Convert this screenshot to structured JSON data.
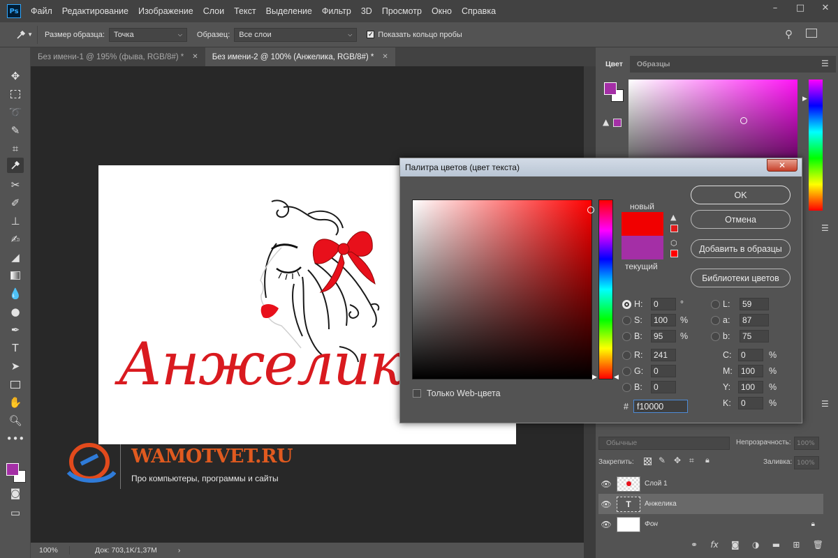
{
  "app": {
    "logo_text": "Ps"
  },
  "menu": [
    "Файл",
    "Редактирование",
    "Изображение",
    "Слои",
    "Текст",
    "Выделение",
    "Фильтр",
    "3D",
    "Просмотр",
    "Окно",
    "Справка"
  ],
  "window_controls": {
    "minimize": "–",
    "maximize": "□",
    "close": "✕"
  },
  "options": {
    "sample_size_label": "Размер образца:",
    "sample_size_value": "Точка",
    "sample_label": "Образец:",
    "sample_value": "Все слои",
    "show_ring_label": "Показать кольцо пробы"
  },
  "tabs": [
    {
      "label": "Без имени-1 @ 195% (фыва, RGB/8#) *",
      "active": false
    },
    {
      "label": "Без имени-2 @ 100% (Анжелика, RGB/8#) *",
      "active": true
    }
  ],
  "document": {
    "script_text": "Анжелик",
    "colors": {
      "red": "#e8101b",
      "text_red": "#d91a1f"
    }
  },
  "watermark": {
    "site": "WAMOTVET.RU",
    "tagline": "Про компьютеры, программы и сайты"
  },
  "status": {
    "zoom": "100%",
    "doc": "Док: 703,1K/1,37M"
  },
  "color_panel": {
    "tabs": [
      "Цвет",
      "Образцы"
    ],
    "fg": "#a42fa6",
    "bg": "#ffffff"
  },
  "layers_panel": {
    "blend_mode": "Обычные",
    "opacity_label": "Непрозрачность:",
    "opacity_value": "100%",
    "lock_label": "Закрепить:",
    "fill_label": "Заливка:",
    "fill_value": "100%",
    "layers": [
      {
        "name": "Слой 1",
        "active": false
      },
      {
        "name": "Анжелика",
        "active": true
      },
      {
        "name": "Фон",
        "active": false
      }
    ]
  },
  "picker": {
    "title": "Палитра цветов (цвет текста)",
    "new_label": "новый",
    "current_label": "текущий",
    "new_color": "#f10000",
    "current_color": "#a42fa6",
    "buttons": {
      "ok": "OK",
      "cancel": "Отмена",
      "add_swatch": "Добавить в образцы",
      "libraries": "Библиотеки цветов"
    },
    "web_only_label": "Только Web-цвета",
    "fields": {
      "H": "0",
      "S": "100",
      "B": "95",
      "R": "241",
      "G": "0",
      "Bv": "0",
      "L": "59",
      "a": "87",
      "b": "75",
      "C": "0",
      "M": "100",
      "Y": "100",
      "K": "0"
    },
    "units": {
      "deg": "°",
      "pct": "%"
    },
    "hash": "#",
    "hex": "f10000"
  }
}
